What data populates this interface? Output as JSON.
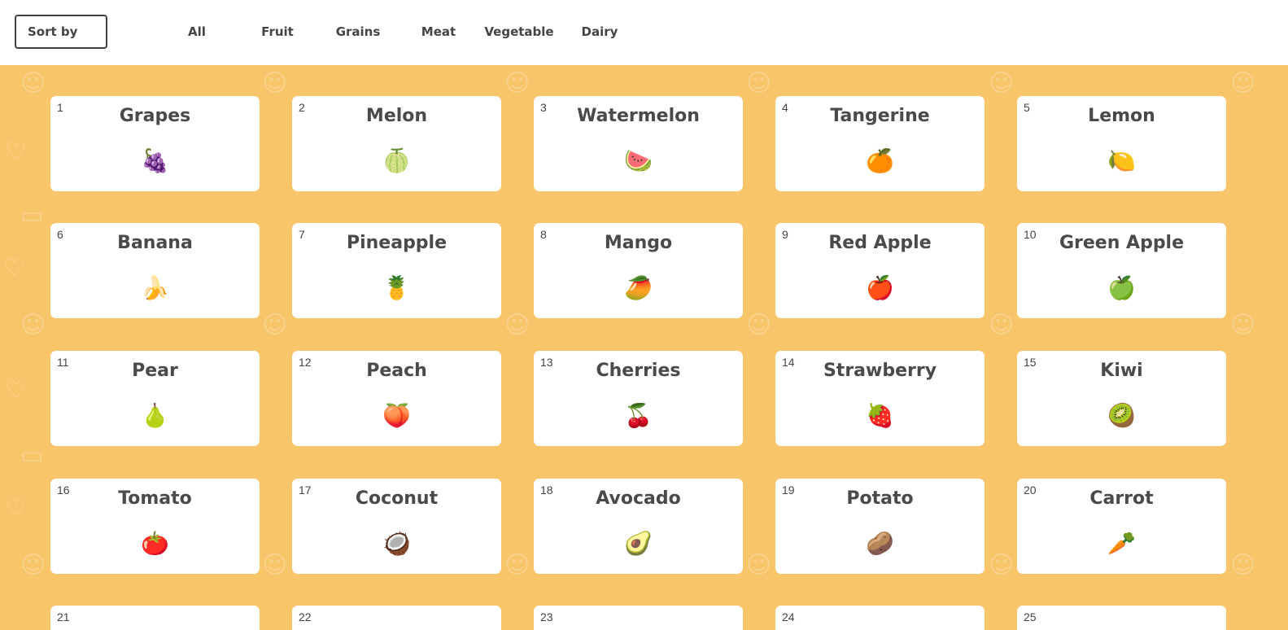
{
  "toolbar": {
    "sort_label": "Sort by",
    "filters": [
      "All",
      "Fruit",
      "Grains",
      "Meat",
      "Vegetable",
      "Dairy"
    ]
  },
  "cards": [
    {
      "number": "1",
      "name": "Grapes",
      "icon": "grapes-icon",
      "glyph": "🍇"
    },
    {
      "number": "2",
      "name": "Melon",
      "icon": "melon-icon",
      "glyph": "🍈"
    },
    {
      "number": "3",
      "name": "Watermelon",
      "icon": "watermelon-icon",
      "glyph": "🍉"
    },
    {
      "number": "4",
      "name": "Tangerine",
      "icon": "tangerine-icon",
      "glyph": "🍊"
    },
    {
      "number": "5",
      "name": "Lemon",
      "icon": "lemon-icon",
      "glyph": "🍋"
    },
    {
      "number": "6",
      "name": "Banana",
      "icon": "banana-icon",
      "glyph": "🍌"
    },
    {
      "number": "7",
      "name": "Pineapple",
      "icon": "pineapple-icon",
      "glyph": "🍍"
    },
    {
      "number": "8",
      "name": "Mango",
      "icon": "mango-icon",
      "glyph": "🥭"
    },
    {
      "number": "9",
      "name": "Red Apple",
      "icon": "red-apple-icon",
      "glyph": "🍎"
    },
    {
      "number": "10",
      "name": "Green Apple",
      "icon": "green-apple-icon",
      "glyph": "🍏"
    },
    {
      "number": "11",
      "name": "Pear",
      "icon": "pear-icon",
      "glyph": "🍐"
    },
    {
      "number": "12",
      "name": "Peach",
      "icon": "peach-icon",
      "glyph": "🍑"
    },
    {
      "number": "13",
      "name": "Cherries",
      "icon": "cherries-icon",
      "glyph": "🍒"
    },
    {
      "number": "14",
      "name": "Strawberry",
      "icon": "strawberry-icon",
      "glyph": "🍓"
    },
    {
      "number": "15",
      "name": "Kiwi",
      "icon": "kiwi-icon",
      "glyph": "🥝"
    },
    {
      "number": "16",
      "name": "Tomato",
      "icon": "tomato-icon",
      "glyph": "🍅"
    },
    {
      "number": "17",
      "name": "Coconut",
      "icon": "coconut-icon",
      "glyph": "🥥"
    },
    {
      "number": "18",
      "name": "Avocado",
      "icon": "avocado-icon",
      "glyph": "🥑"
    },
    {
      "number": "19",
      "name": "Potato",
      "icon": "potato-icon",
      "glyph": "🥔"
    },
    {
      "number": "20",
      "name": "Carrot",
      "icon": "carrot-icon",
      "glyph": "🥕"
    },
    {
      "number": "21",
      "name": "",
      "icon": "",
      "glyph": ""
    },
    {
      "number": "22",
      "name": "",
      "icon": "",
      "glyph": ""
    },
    {
      "number": "23",
      "name": "",
      "icon": "",
      "glyph": ""
    },
    {
      "number": "24",
      "name": "",
      "icon": "",
      "glyph": ""
    },
    {
      "number": "25",
      "name": "",
      "icon": "",
      "glyph": ""
    }
  ],
  "colors": {
    "background": "#f9c56a",
    "card": "#ffffff",
    "text": "#4a4a4a"
  }
}
